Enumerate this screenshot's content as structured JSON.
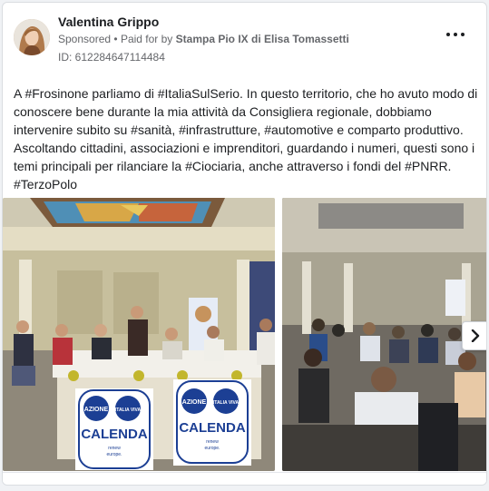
{
  "post": {
    "author": "Valentina Grippo",
    "sponsored_label": "Sponsored",
    "separator": "•",
    "paid_for_prefix": "Paid for by",
    "paid_for_by": "Stampa Pio IX di Elisa Tomassetti",
    "id_line": "ID: 612284647114484",
    "text": "A #Frosinone parliamo di #ItaliaSulSerio. In questo territorio, che ho avuto modo di conoscere bene durante la mia attività da Consigliera regionale, dobbiamo intervenire subito su #sanità, #infrastrutture, #automotive e comparto produttivo. Ascoltando cittadini, associazioni e imprenditori, guardando i numeri, questi sono i temi principali per rilanciare la #Ciociaria, anche attraverso i fondi del #PNRR. #TerzoPolo"
  },
  "banners": {
    "azione": "AZIONE",
    "italia_viva": "ITALIA VIVA",
    "calenda": "CALENDA",
    "tagline_1": "renew",
    "tagline_2": "europe."
  },
  "icons": {
    "more": "more-options-icon",
    "next": "chevron-right-icon"
  },
  "colors": {
    "text": "#1c1e21",
    "secondary": "#65676b",
    "calenda_blue": "#1c3f94"
  }
}
